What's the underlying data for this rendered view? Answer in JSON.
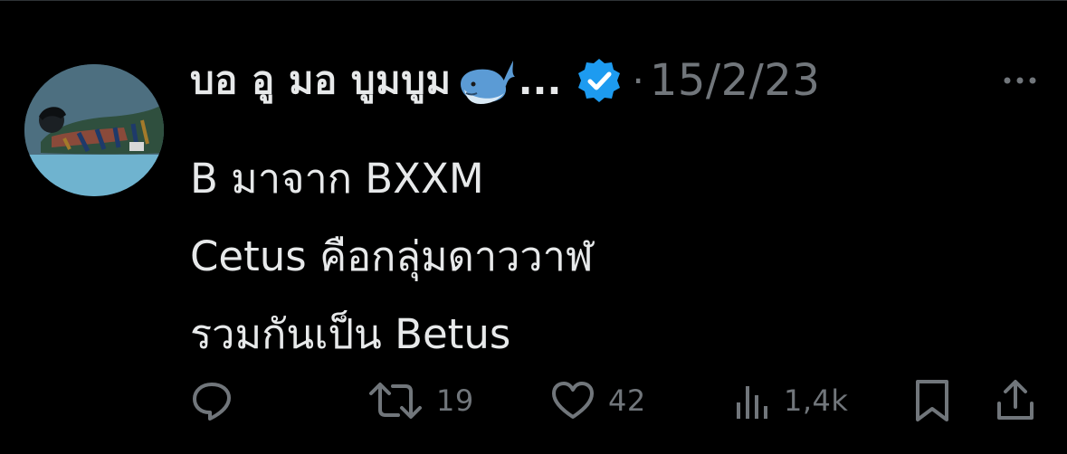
{
  "tweet": {
    "display_name": "บอ อู มอ บูมบูม",
    "name_emoji_icon": "whale-emoji",
    "name_truncation": "...",
    "verified_icon": "verified-badge-icon",
    "separator": "·",
    "date": "15/2/23",
    "more_icon": "more-horizontal-icon",
    "text_lines": [
      "B มาจาก BXXM",
      "Cetus คือกลุ่มดาววาฬ",
      "รวมกันเป็น Betus"
    ]
  },
  "actions": {
    "reply": {
      "icon": "reply-icon",
      "count": ""
    },
    "retweet": {
      "icon": "retweet-icon",
      "count": "19"
    },
    "like": {
      "icon": "heart-icon",
      "count": "42"
    },
    "views": {
      "icon": "views-icon",
      "count": "1,4k"
    },
    "bookmark": {
      "icon": "bookmark-icon"
    },
    "share": {
      "icon": "share-icon"
    }
  },
  "colors": {
    "background": "#000000",
    "primary_text": "#e7e9ea",
    "secondary_text": "#71767b",
    "verified_blue": "#1d9bf0",
    "divider": "#2f3336"
  }
}
